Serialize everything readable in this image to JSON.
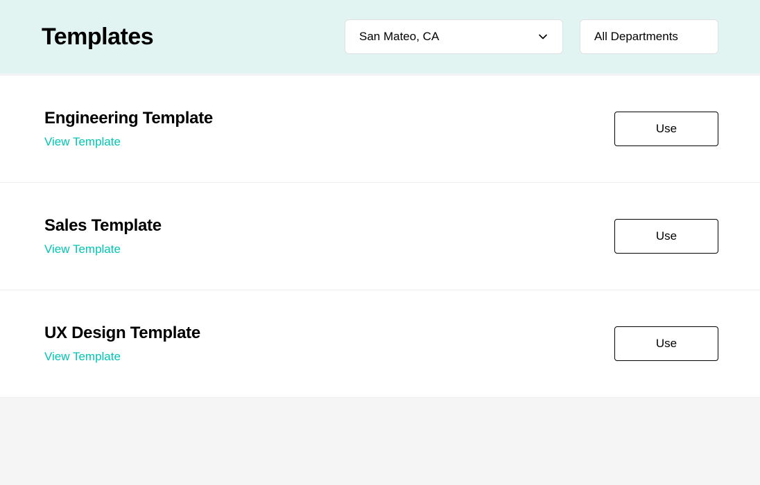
{
  "header": {
    "title": "Templates",
    "location_selected": "San Mateo, CA",
    "department_selected": "All Departments"
  },
  "templates": [
    {
      "name": "Engineering Template",
      "view_label": "View Template",
      "use_label": "Use"
    },
    {
      "name": "Sales Template",
      "view_label": "View Template",
      "use_label": "Use"
    },
    {
      "name": "UX Design Template",
      "view_label": "View Template",
      "use_label": "Use"
    }
  ]
}
